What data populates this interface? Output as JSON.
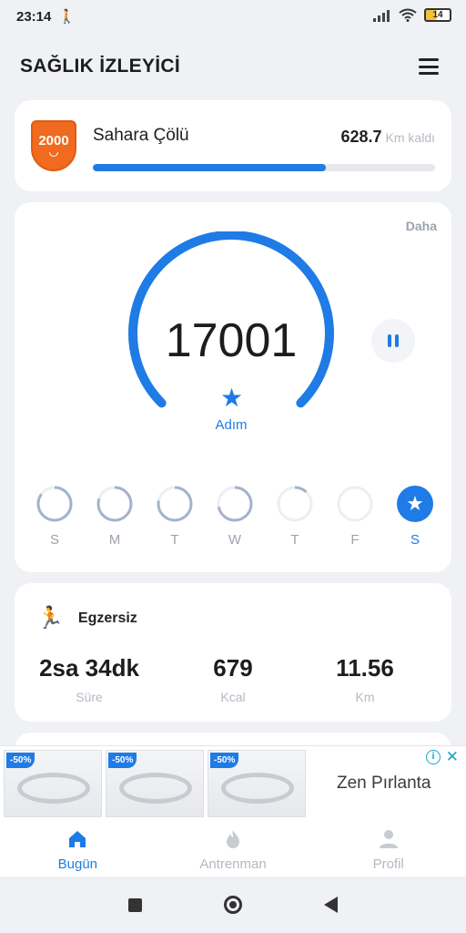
{
  "status_bar": {
    "time": "23:14",
    "battery": "14",
    "walk_icon": "walking-person-icon"
  },
  "header": {
    "title": "SAĞLIK İZLEYİCİ"
  },
  "challenge": {
    "badge": "2000",
    "name": "Sahara Çölü",
    "remaining_value": "628.7",
    "remaining_unit": "Km kaldı",
    "progress": 0.68
  },
  "steps": {
    "more_label": "Daha",
    "count": "17001",
    "unit_label": "Adım",
    "gauge_progress": 1.0,
    "days": [
      {
        "label": "S",
        "progress": 0.85,
        "active": false
      },
      {
        "label": "M",
        "progress": 0.8,
        "active": false
      },
      {
        "label": "T",
        "progress": 0.78,
        "active": false
      },
      {
        "label": "W",
        "progress": 0.72,
        "active": false
      },
      {
        "label": "T",
        "progress": 0.12,
        "active": false
      },
      {
        "label": "F",
        "progress": 0.0,
        "active": false
      },
      {
        "label": "S",
        "progress": 1.0,
        "active": true
      }
    ]
  },
  "exercise": {
    "title": "Egzersiz",
    "stats": [
      {
        "value": "2sa 34dk",
        "label": "Süre"
      },
      {
        "value": "679",
        "label": "Kcal"
      },
      {
        "value": "11.56",
        "label": "Km"
      }
    ]
  },
  "ad": {
    "discount": "-50%",
    "brand": "Zen Pırlanta",
    "info_icon": "info-icon",
    "close_icon": "close-icon"
  },
  "bottom_nav": [
    {
      "label": "Bugün",
      "icon": "home-icon",
      "active": true
    },
    {
      "label": "Antrenman",
      "icon": "flame-icon",
      "active": false
    },
    {
      "label": "Profil",
      "icon": "person-icon",
      "active": false
    }
  ],
  "colors": {
    "accent": "#1f7be5",
    "badge": "#f06a1f",
    "track": "#e6e8ec",
    "muted": "#b5b9c2"
  }
}
